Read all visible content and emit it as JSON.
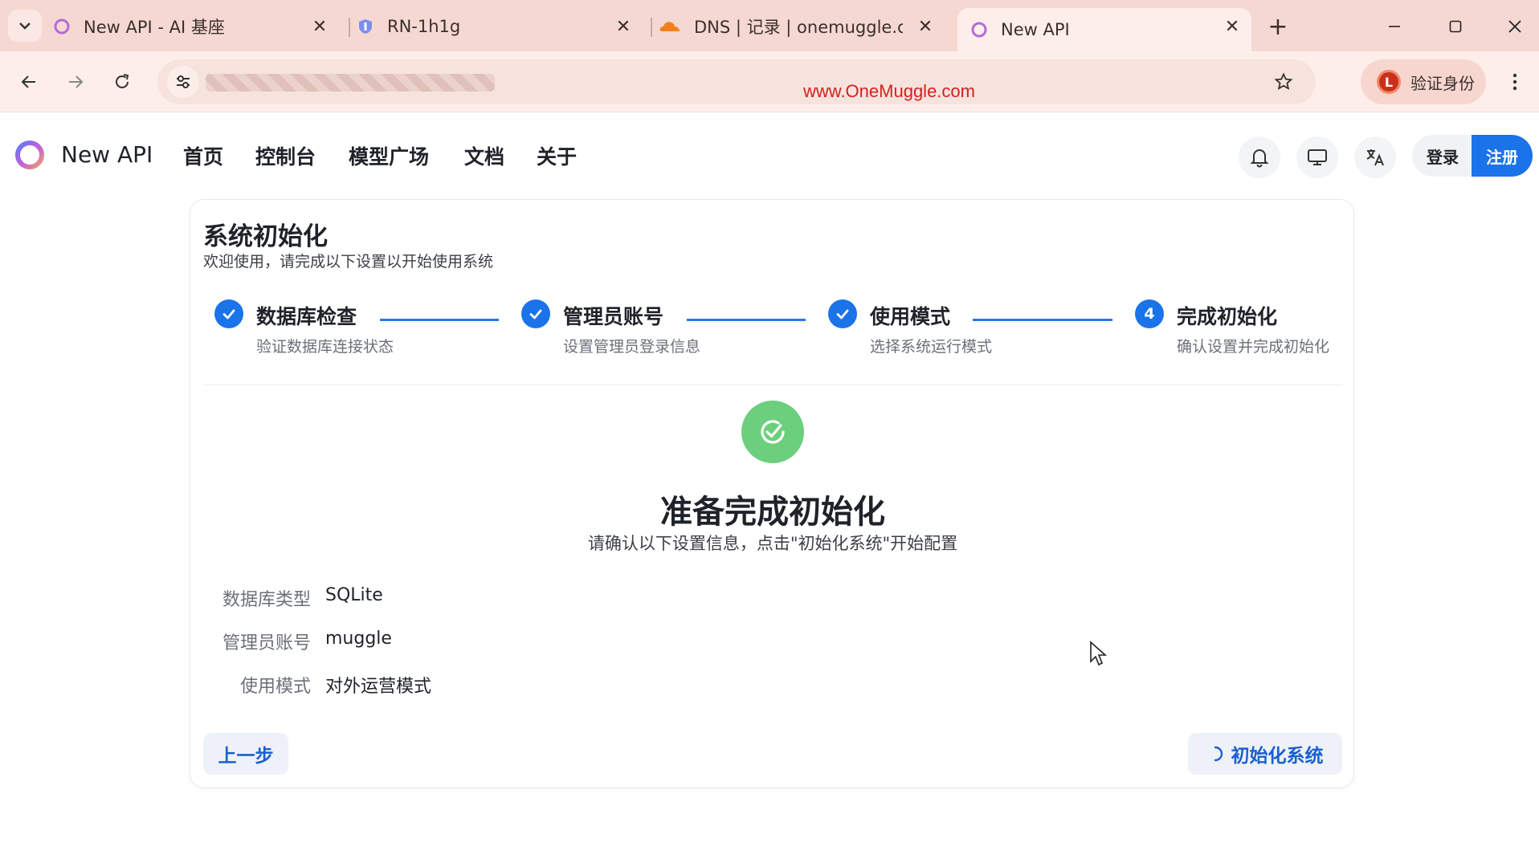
{
  "browser": {
    "tabs": [
      {
        "title": "New API - AI 基座",
        "active": false
      },
      {
        "title": "RN-1h1g",
        "active": false
      },
      {
        "title": "DNS | 记录 | onemuggle.com",
        "active": false
      },
      {
        "title": "New API",
        "active": true
      }
    ],
    "close_glyph": "✕",
    "new_tab_glyph": "+",
    "watermark": "www.OneMuggle.com",
    "profile_label": "验证身份",
    "profile_initial": "L",
    "accent_color": "#f6d8d2"
  },
  "app": {
    "brand": "New API",
    "nav": [
      "首页",
      "控制台",
      "模型广场",
      "文档",
      "关于"
    ],
    "login_label": "登录",
    "signup_label": "注册",
    "primary_color": "#1a73e8"
  },
  "setup": {
    "title": "系统初始化",
    "subtitle": "欢迎使用，请完成以下设置以开始使用系统",
    "steps": [
      {
        "title": "数据库检查",
        "desc": "验证数据库连接状态",
        "status": "done"
      },
      {
        "title": "管理员账号",
        "desc": "设置管理员登录信息",
        "status": "done"
      },
      {
        "title": "使用模式",
        "desc": "选择系统运行模式",
        "status": "done"
      },
      {
        "title": "完成初始化",
        "desc": "确认设置并完成初始化",
        "status": "current",
        "number": "4"
      }
    ],
    "ready_title": "准备完成初始化",
    "ready_subtitle": "请确认以下设置信息，点击\"初始化系统\"开始配置",
    "summary": [
      {
        "label": "数据库类型",
        "value": "SQLite"
      },
      {
        "label": "管理员账号",
        "value": "muggle"
      },
      {
        "label": "使用模式",
        "value": "对外运营模式"
      }
    ],
    "prev_label": "上一步",
    "init_label": "初始化系统",
    "success_color": "#6ccf7e"
  }
}
